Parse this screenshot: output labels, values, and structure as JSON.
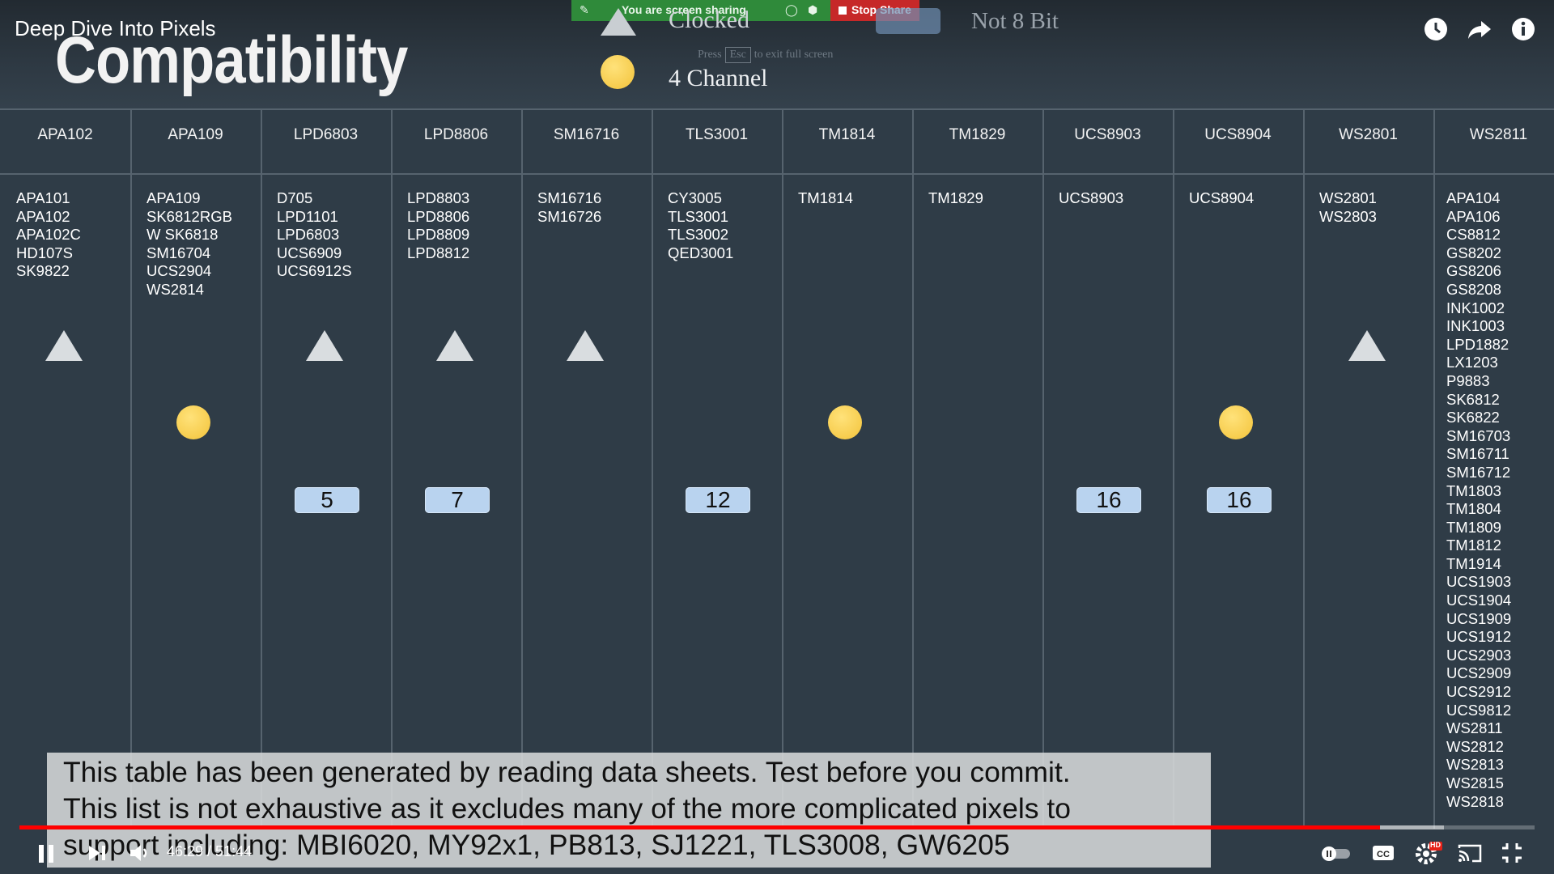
{
  "video": {
    "title": "Deep Dive Into Pixels",
    "current_time": "46:29",
    "duration": "51:44",
    "time_display": "46:29 / 51:44",
    "progress_fraction": 0.898,
    "buffered_fraction": 0.94
  },
  "slide": {
    "title": "Compatibility",
    "legend": {
      "triangle_label": "Clocked",
      "circle_label": "4 Channel",
      "rect_label": "Not 8 Bit"
    },
    "esc_hint": {
      "press": "Press",
      "key": "Esc",
      "rest": "to exit full screen"
    }
  },
  "screen_share": {
    "message": "You are screen sharing",
    "stop_label": "Stop Share"
  },
  "table": {
    "columns": [
      {
        "header": "APA102",
        "items": [
          "APA101",
          "APA102",
          "APA102C",
          "HD107S",
          "SK9822"
        ],
        "clocked": true,
        "four_channel": false,
        "not8bit": ""
      },
      {
        "header": "APA109",
        "items": [
          "APA109",
          "SK6812RGB",
          "W SK6818",
          "SM16704",
          "UCS2904",
          "WS2814"
        ],
        "clocked": false,
        "four_channel": true,
        "not8bit": ""
      },
      {
        "header": "LPD6803",
        "items": [
          "D705",
          "LPD1101",
          "LPD6803",
          "UCS6909",
          "UCS6912S"
        ],
        "clocked": true,
        "four_channel": false,
        "not8bit": "5"
      },
      {
        "header": "LPD8806",
        "items": [
          "LPD8803",
          "LPD8806",
          "LPD8809",
          "LPD8812"
        ],
        "clocked": true,
        "four_channel": false,
        "not8bit": "7"
      },
      {
        "header": "SM16716",
        "items": [
          "SM16716",
          "SM16726"
        ],
        "clocked": true,
        "four_channel": false,
        "not8bit": ""
      },
      {
        "header": "TLS3001",
        "items": [
          "CY3005",
          "TLS3001",
          "TLS3002",
          "QED3001"
        ],
        "clocked": false,
        "four_channel": false,
        "not8bit": "12"
      },
      {
        "header": "TM1814",
        "items": [
          "TM1814"
        ],
        "clocked": false,
        "four_channel": true,
        "not8bit": ""
      },
      {
        "header": "TM1829",
        "items": [
          "TM1829"
        ],
        "clocked": false,
        "four_channel": false,
        "not8bit": ""
      },
      {
        "header": "UCS8903",
        "items": [
          "UCS8903"
        ],
        "clocked": false,
        "four_channel": false,
        "not8bit": "16"
      },
      {
        "header": "UCS8904",
        "items": [
          "UCS8904"
        ],
        "clocked": false,
        "four_channel": true,
        "not8bit": "16"
      },
      {
        "header": "WS2801",
        "items": [
          "WS2801",
          "WS2803"
        ],
        "clocked": true,
        "four_channel": false,
        "not8bit": ""
      },
      {
        "header": "WS2811",
        "items": [
          "APA104",
          "APA106",
          "CS8812",
          "GS8202",
          "GS8206",
          "GS8208",
          "INK1002",
          "INK1003",
          "LPD1882",
          "LX1203",
          "P9883",
          "SK6812",
          "SK6822",
          "SM16703",
          "SM16711",
          "SM16712",
          "TM1803",
          "TM1804",
          "TM1809",
          "TM1812",
          "TM1914",
          "UCS1903",
          "UCS1904",
          "UCS1909",
          "UCS1912",
          "UCS2903",
          "UCS2909",
          "UCS2912",
          "UCS9812",
          "WS2811",
          "WS2812",
          "WS2813",
          "WS2815",
          "WS2818"
        ],
        "clocked": false,
        "four_channel": false,
        "not8bit": ""
      }
    ]
  },
  "caption": {
    "line1": "This table has been generated by reading data sheets. Test before you commit.",
    "line2": "This list is not exhaustive as it excludes many of the more complicated pixels to",
    "line3": "support including: MBI6020, MY92x1, PB813, SJ1221, TLS3008, GW6205"
  },
  "icons": {
    "watch_later": "clock-icon",
    "share": "share-icon",
    "info": "info-icon",
    "play_pause": "pause-icon",
    "next": "next-icon",
    "volume": "volume-icon",
    "autoplay": "autoplay-toggle-icon",
    "captions": "cc-icon",
    "settings": "gear-icon",
    "cast": "cast-icon",
    "fullscreen_exit": "exit-fullscreen-icon"
  },
  "settings_badge": "HD"
}
